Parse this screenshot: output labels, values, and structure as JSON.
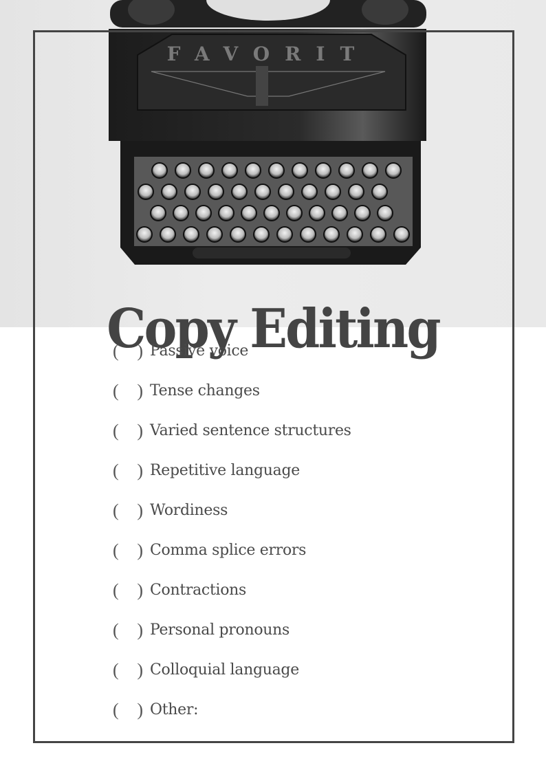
{
  "document": {
    "title": "Copy Editing",
    "hero_image": "typewriter-photo",
    "hero_brand_text": "FAVORIT",
    "colors": {
      "text": "#444444",
      "frame": "#444444",
      "photo_background": "#e6e6e6"
    },
    "checklist": {
      "box_open": "(",
      "box_close": ")",
      "items": [
        {
          "label": "Passive voice",
          "checked": false
        },
        {
          "label": "Tense changes",
          "checked": false
        },
        {
          "label": "Varied sentence structures",
          "checked": false
        },
        {
          "label": "Repetitive language",
          "checked": false
        },
        {
          "label": "Wordiness",
          "checked": false
        },
        {
          "label": "Comma splice errors",
          "checked": false
        },
        {
          "label": "Contractions",
          "checked": false
        },
        {
          "label": "Personal pronouns",
          "checked": false
        },
        {
          "label": "Colloquial language",
          "checked": false
        },
        {
          "label": "Other:",
          "checked": false
        }
      ]
    }
  }
}
